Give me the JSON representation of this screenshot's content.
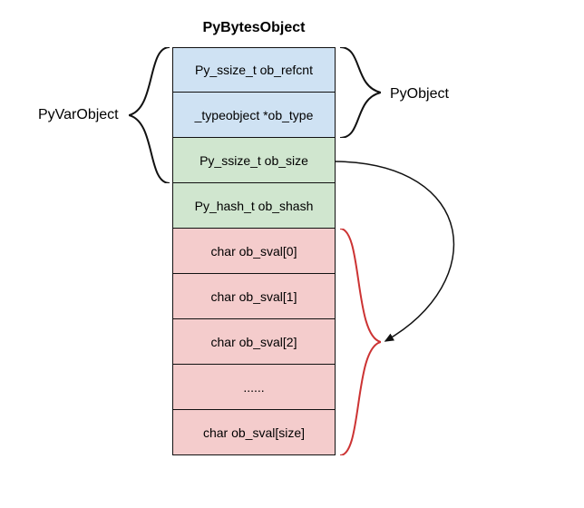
{
  "title": "PyBytesObject",
  "groups": {
    "pyvarobject_label": "PyVarObject",
    "pyobject_label": "PyObject"
  },
  "cells": {
    "c0": "Py_ssize_t ob_refcnt",
    "c1": "_typeobject *ob_type",
    "c2": "Py_ssize_t ob_size",
    "c3": "Py_hash_t ob_shash",
    "c4": "char ob_sval[0]",
    "c5": "char ob_sval[1]",
    "c6": "char ob_sval[2]",
    "c7": "......",
    "c8": "char ob_sval[size]"
  },
  "colors": {
    "pyobject": "#cfe2f3",
    "pyvarobject_extra": "#d0e6cf",
    "sval": "#f4cccc",
    "sval_brace": "#cc3333"
  },
  "chart_data": {
    "type": "table",
    "title": "PyBytesObject memory layout",
    "groups": [
      {
        "name": "PyObject",
        "fields": [
          "Py_ssize_t ob_refcnt",
          "_typeobject *ob_type"
        ]
      },
      {
        "name": "PyVarObject",
        "fields": [
          "Py_ssize_t ob_refcnt",
          "_typeobject *ob_type",
          "Py_ssize_t ob_size"
        ]
      }
    ],
    "fields": [
      {
        "type": "Py_ssize_t",
        "name": "ob_refcnt",
        "group": "PyObject"
      },
      {
        "type": "_typeobject*",
        "name": "ob_type",
        "group": "PyObject"
      },
      {
        "type": "Py_ssize_t",
        "name": "ob_size",
        "group": "PyVarObject"
      },
      {
        "type": "Py_hash_t",
        "name": "ob_shash"
      },
      {
        "type": "char[]",
        "name": "ob_sval",
        "elements": [
          "ob_sval[0]",
          "ob_sval[1]",
          "ob_sval[2]",
          "...",
          "ob_sval[size]"
        ],
        "length_from": "ob_size"
      }
    ],
    "arrow": {
      "from": "ob_size",
      "to": "ob_sval",
      "meaning": "ob_size gives the element count of ob_sval"
    }
  }
}
